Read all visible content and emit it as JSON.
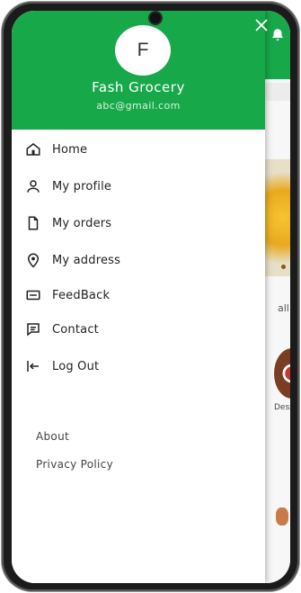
{
  "drawer": {
    "avatar_initial": "F",
    "name": "Fash Grocery",
    "email": "abc@gmail.com",
    "close_icon": "close-icon",
    "menu": [
      {
        "label": "Home",
        "icon": "home-icon"
      },
      {
        "label": "My profile",
        "icon": "user-icon"
      },
      {
        "label": "My orders",
        "icon": "document-icon"
      },
      {
        "label": "My address",
        "icon": "location-pin-icon"
      },
      {
        "label": "FeedBack",
        "icon": "feedback-icon"
      },
      {
        "label": "Contact",
        "icon": "message-icon"
      },
      {
        "label": "Log Out",
        "icon": "logout-icon"
      }
    ],
    "footer_links": [
      "About",
      "Privacy Policy"
    ]
  },
  "background": {
    "see_all_label": "all >",
    "category_label": "Desse"
  },
  "colors": {
    "primary_green": "#17a84a",
    "text_dark": "#222222",
    "text_muted": "#444444"
  }
}
